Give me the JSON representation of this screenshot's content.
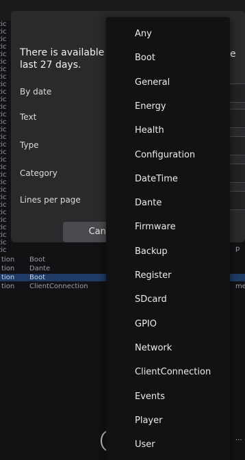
{
  "background": {
    "left_fragments": [
      "zic",
      "zic",
      "zic",
      "zic",
      "zic",
      "zic",
      "zic",
      "zic",
      "zic",
      "zic",
      "zic",
      "zic",
      "zic",
      "zic",
      "zic",
      "zic",
      "zic",
      "zic",
      "zic",
      "zic",
      "zic",
      "zic",
      "zic",
      "zic",
      "zic",
      "zic",
      "zic",
      "zic",
      "zic",
      "zic",
      "zic"
    ],
    "log_rows": [
      {
        "col1": "tion",
        "col2": "Boot"
      },
      {
        "col1": "tion",
        "col2": "Dante"
      },
      {
        "col1": "tion",
        "col2": "Boot"
      },
      {
        "col1": "tion",
        "col2": "ClientConnection"
      }
    ],
    "right_fragments": [
      "p",
      "med"
    ],
    "more_dots": "···"
  },
  "dialog": {
    "message_line1": "There is available",
    "message_line2": "last 27 days.",
    "message_tail": "e",
    "fields": [
      {
        "label": "By date"
      },
      {
        "label": "Text"
      },
      {
        "label": "Type"
      },
      {
        "label": "Category"
      },
      {
        "label": "Lines per page"
      }
    ],
    "cancel_label": "Cance"
  },
  "dropdown": {
    "items": [
      "Any",
      "Boot",
      "General",
      "Energy",
      "Health",
      "Configuration",
      "DateTime",
      "Dante",
      "Firmware",
      "Backup",
      "Register",
      "SDcard",
      "GPIO",
      "Network",
      "ClientConnection",
      "Events",
      "Player",
      "User"
    ]
  }
}
